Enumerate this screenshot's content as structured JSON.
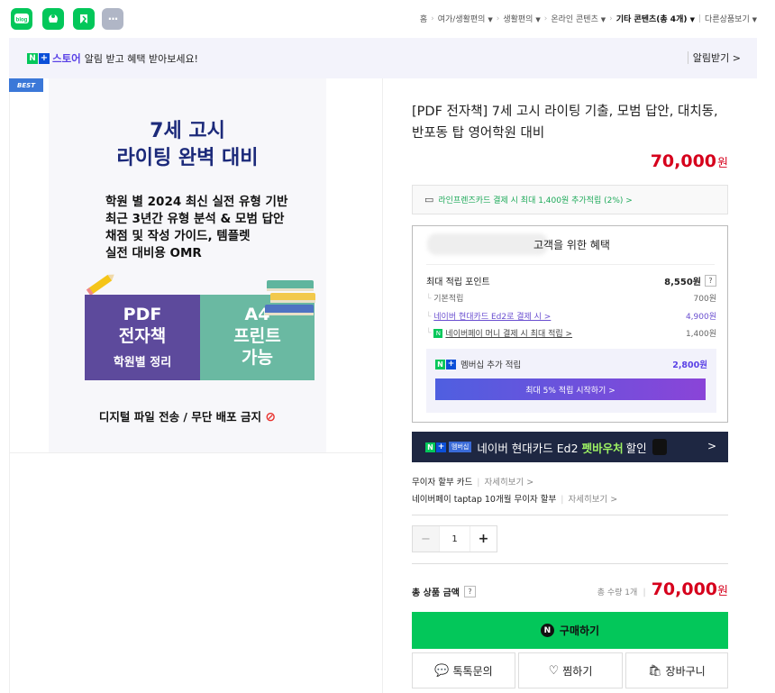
{
  "share_icons": [
    {
      "name": "blog-share-icon",
      "label": "blog",
      "color": "#03c75a"
    },
    {
      "name": "cafe-share-icon",
      "label": "",
      "color": "#03c75a"
    },
    {
      "name": "bookmark-share-icon",
      "label": "",
      "color": "#03c75a"
    },
    {
      "name": "more-share-icon",
      "label": "···",
      "color": "#b0b6c6"
    }
  ],
  "breadcrumbs": [
    "홈",
    "여가/생활편의",
    "생활편의",
    "온라인 콘텐츠",
    "기타 콘텐츠(총 4개)",
    "다른상품보기"
  ],
  "banner": {
    "store": "스토어",
    "text": "알림 받고 혜택 받아보세요!",
    "action": "알림받기 >"
  },
  "badge": "BEST",
  "poster": {
    "title_line1": "7세 고시",
    "title_line2": "라이팅 완벽 대비",
    "bullets": [
      "학원 별 2024 최신 실전 유형 기반",
      "최근 3년간 유형 분석 & 모범 답안",
      "채점 및 작성 가이드, 템플렛",
      "실전 대비용  OMR"
    ],
    "left_block": [
      "PDF",
      "전자책",
      "학원별 정리"
    ],
    "right_block": [
      "A4",
      "프린트",
      "가능"
    ],
    "footer": "디지털 파일 전송 / 무단 배포 금지"
  },
  "product": {
    "title": "[PDF 전자책] 7세 고시 라이팅 기출, 모범 답안, 대치동, 반포동 탑 영어학원 대비",
    "price": "70,000",
    "currency": "원"
  },
  "card_promo": "라인프렌즈카드 결제 시 최대 1,400원 추가적립 (2%) >",
  "benefits": {
    "header": "고객을 위한 혜택",
    "max_points_label": "최대 적립 포인트",
    "max_points_value": "8,550원",
    "help": "?",
    "rows": [
      {
        "label": "기본적립",
        "value": "700원"
      },
      {
        "label": "네이버 현대카드 Ed2로 결제 시 >",
        "value": "4,900원"
      },
      {
        "label": "네이버페이 머니 결제 시 최대 적립 >",
        "value": "1,400원"
      }
    ],
    "membership_label": "멤버십 추가 적립",
    "membership_value": "2,800원",
    "membership_button": "최대 5% 적립 시작하기 >"
  },
  "ad_banner": {
    "tag": "멤버십",
    "text": "네이버 현대카드 Ed2",
    "highlight": "펫바우처",
    "tail": "할인",
    "arrow": ">"
  },
  "installment": [
    {
      "label": "무이자 할부 카드",
      "link": "자세히보기 >"
    },
    {
      "label": "네이버페이 taptap 10개월 무이자 할부",
      "link": "자세히보기 >"
    }
  ],
  "quantity": {
    "minus": "−",
    "value": "1",
    "plus": "+"
  },
  "total": {
    "label": "총 상품 금액",
    "help": "?",
    "qty_text": "총 수량 1개",
    "price": "70,000",
    "currency": "원"
  },
  "buttons": {
    "buy": "구매하기",
    "talk": "톡톡문의",
    "wish": "찜하기",
    "cart": "장바구니"
  },
  "colors": {
    "naver_green": "#03c75a",
    "price_red": "#d6001c",
    "poster_purple": "#5d4a9c",
    "poster_teal": "#6ab9a2",
    "poster_navy": "#1c2a7a"
  }
}
